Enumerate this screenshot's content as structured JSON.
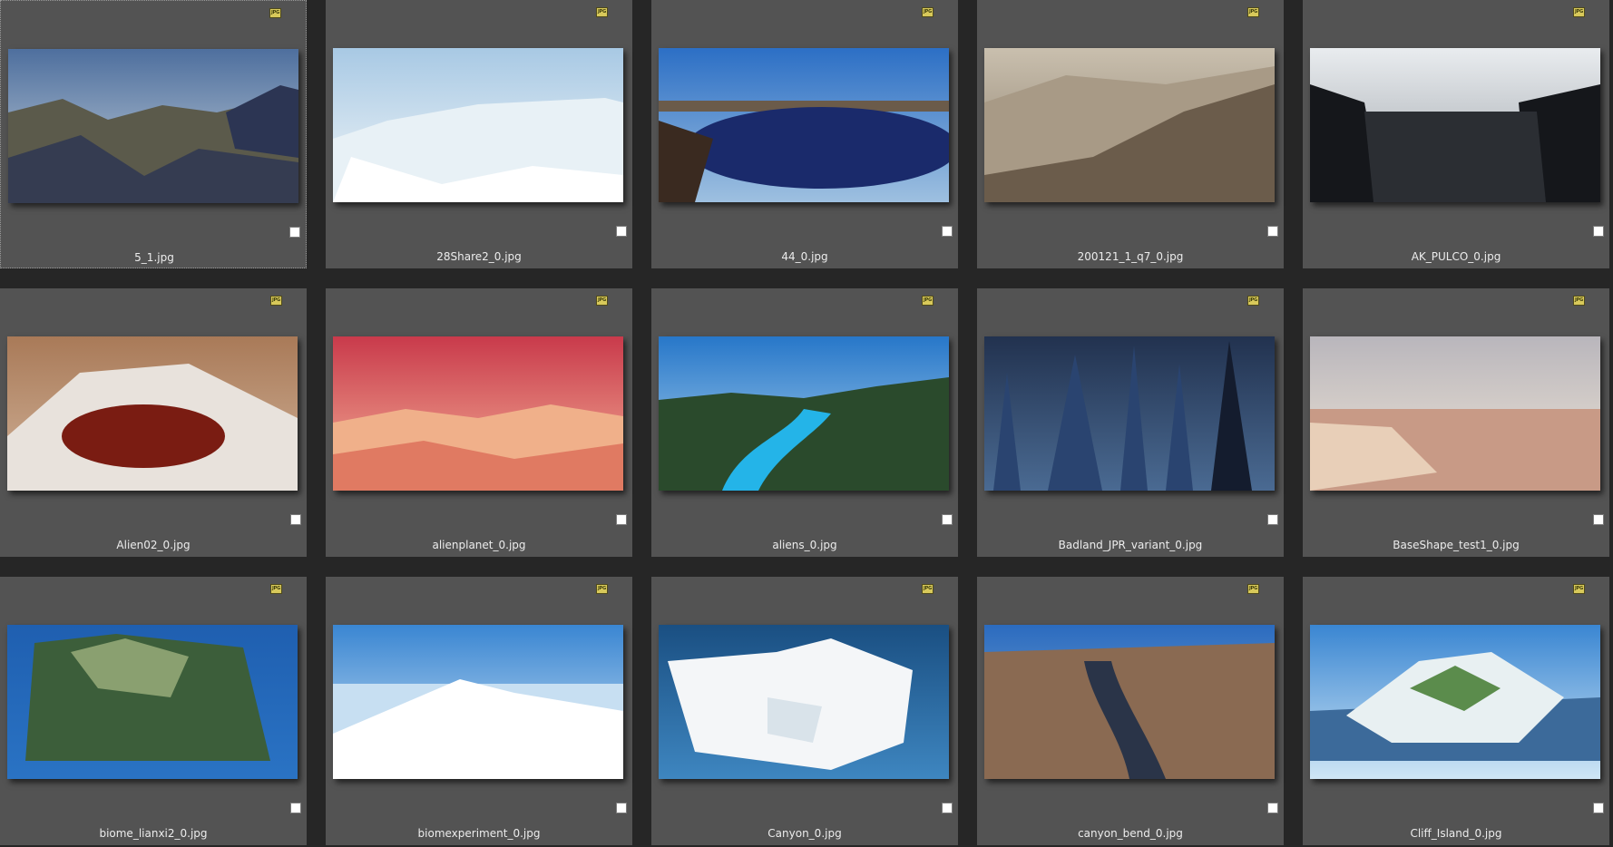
{
  "file_type_badge": "JPG",
  "items": [
    {
      "name": "5_1.jpg",
      "scene": "desert-rocks",
      "selected_outline": true,
      "checked": false,
      "sky": [
        "#4e6f9e",
        "#c9d4dc"
      ],
      "ground": [
        "#5b5a4b",
        "#2c3553"
      ]
    },
    {
      "name": "28Share2_0.jpg",
      "scene": "ice-shelf",
      "selected_outline": false,
      "checked": false,
      "sky": [
        "#a8c9e4",
        "#f2f6f8"
      ],
      "ground": [
        "#e8f1f6",
        "#ffffff"
      ]
    },
    {
      "name": "44_0.jpg",
      "scene": "blue-lake",
      "selected_outline": false,
      "checked": false,
      "sky": [
        "#2c6fc5",
        "#9ec0e0"
      ],
      "ground": [
        "#1a2a6b",
        "#3a2a20"
      ]
    },
    {
      "name": "200121_1_q7_0.jpg",
      "scene": "sand-ridge",
      "selected_outline": false,
      "checked": false,
      "sky": [
        "#c9bfae",
        "#8a7d6a"
      ],
      "ground": [
        "#6b5c4b",
        "#a89a86"
      ]
    },
    {
      "name": "AK_PULCO_0.jpg",
      "scene": "dark-canyon",
      "selected_outline": false,
      "checked": false,
      "sky": [
        "#e9ecef",
        "#9aa0a6"
      ],
      "ground": [
        "#2b2e33",
        "#15171b"
      ]
    },
    {
      "name": "Alien02_0.jpg",
      "scene": "red-crater",
      "selected_outline": false,
      "checked": false,
      "sky": [
        "#a97a58",
        "#d1b39a"
      ],
      "ground": [
        "#7a1c12",
        "#e8e2dc"
      ]
    },
    {
      "name": "alienplanet_0.jpg",
      "scene": "pink-dunes",
      "selected_outline": false,
      "checked": false,
      "sky": [
        "#c93a4b",
        "#f5b59a"
      ],
      "ground": [
        "#f0b08a",
        "#e07a62"
      ]
    },
    {
      "name": "aliens_0.jpg",
      "scene": "river-valley",
      "selected_outline": false,
      "checked": false,
      "sky": [
        "#2777c9",
        "#b4d8f0"
      ],
      "ground": [
        "#2a4a2c",
        "#24b4e8"
      ]
    },
    {
      "name": "Badland_JPR_variant_0.jpg",
      "scene": "spires",
      "selected_outline": false,
      "checked": false,
      "sky": [
        "#22324f",
        "#4a6a92"
      ],
      "ground": [
        "#141c2e",
        "#2a4470"
      ]
    },
    {
      "name": "BaseShape_test1_0.jpg",
      "scene": "pink-flats",
      "selected_outline": false,
      "checked": false,
      "sky": [
        "#b9b6bc",
        "#f1e6d6"
      ],
      "ground": [
        "#e8cfb8",
        "#c89a86"
      ]
    },
    {
      "name": "biome_lianxi2_0.jpg",
      "scene": "green-terrain",
      "selected_outline": false,
      "checked": false,
      "sky": [
        "#1f5fb0",
        "#2a73c4"
      ],
      "ground": [
        "#3c5e3a",
        "#8aa070"
      ]
    },
    {
      "name": "biomexperiment_0.jpg",
      "scene": "snow-ridge",
      "selected_outline": false,
      "checked": false,
      "sky": [
        "#3a86d2",
        "#cfe4f4"
      ],
      "ground": [
        "#c7dff2",
        "#ffffff"
      ]
    },
    {
      "name": "Canyon_0.jpg",
      "scene": "white-block",
      "selected_outline": false,
      "checked": false,
      "sky": [
        "#1a4f82",
        "#3e86c0"
      ],
      "ground": [
        "#f4f6f8",
        "#d9e3ea"
      ]
    },
    {
      "name": "canyon_bend_0.jpg",
      "scene": "canyon-river",
      "selected_outline": false,
      "checked": false,
      "sky": [
        "#2b6bbf",
        "#8fb6d8"
      ],
      "ground": [
        "#8a6a52",
        "#2a3448"
      ]
    },
    {
      "name": "Cliff_Island_0.jpg",
      "scene": "island",
      "selected_outline": false,
      "checked": false,
      "sky": [
        "#3a86d2",
        "#cfe6f5"
      ],
      "ground": [
        "#3c6a9a",
        "#e8f0f2"
      ]
    }
  ]
}
